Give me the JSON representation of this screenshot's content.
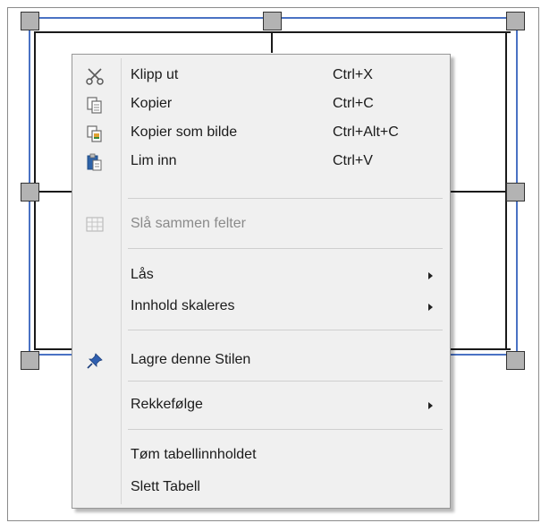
{
  "context_menu": {
    "items": [
      {
        "label": "Klipp ut",
        "shortcut": "Ctrl+X",
        "icon": "scissors-icon",
        "enabled": true
      },
      {
        "label": "Kopier",
        "shortcut": "Ctrl+C",
        "icon": "copy-icon",
        "enabled": true
      },
      {
        "label": "Kopier som bilde",
        "shortcut": "Ctrl+Alt+C",
        "icon": "copy-as-image-icon",
        "enabled": true
      },
      {
        "label": "Lim inn",
        "shortcut": "Ctrl+V",
        "icon": "paste-icon",
        "enabled": true
      },
      {
        "label": "Slå sammen felter",
        "shortcut": "",
        "icon": "merge-cells-icon",
        "enabled": false
      },
      {
        "label": "Lås",
        "shortcut": "",
        "icon": "",
        "enabled": true,
        "submenu": true
      },
      {
        "label": "Innhold skaleres",
        "shortcut": "",
        "icon": "",
        "enabled": true,
        "submenu": true
      },
      {
        "label": "Lagre denne Stilen",
        "shortcut": "",
        "icon": "pin-icon",
        "enabled": true
      },
      {
        "label": "Rekkefølge",
        "shortcut": "",
        "icon": "",
        "enabled": true,
        "submenu": true
      },
      {
        "label": "Tøm tabellinnholdet",
        "shortcut": "",
        "icon": "",
        "enabled": true
      },
      {
        "label": "Slett Tabell",
        "shortcut": "",
        "icon": "",
        "enabled": true
      }
    ]
  },
  "colors": {
    "selection_blue": "#4a72c4",
    "menu_background": "#f0f0f0",
    "disabled_text": "#8a8a8a",
    "handle_fill": "#b3b3b3"
  }
}
